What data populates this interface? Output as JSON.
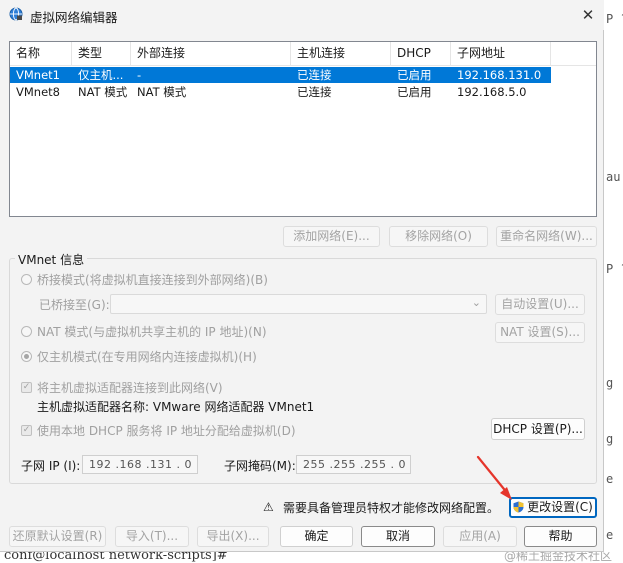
{
  "window": {
    "title": "虚拟网络编辑器",
    "close_symbol": "✕"
  },
  "list": {
    "headers": [
      "名称",
      "类型",
      "外部连接",
      "主机连接",
      "DHCP",
      "子网地址"
    ],
    "rows": [
      [
        "VMnet1",
        "仅主机...",
        "-",
        "已连接",
        "已启用",
        "192.168.131.0"
      ],
      [
        "VMnet8",
        "NAT 模式",
        "NAT 模式",
        "已连接",
        "已启用",
        "192.168.5.0"
      ]
    ],
    "selected_row": 0
  },
  "list_buttons": {
    "add": "添加网络(E)...",
    "remove": "移除网络(O)",
    "rename": "重命名网络(W)..."
  },
  "vmnet_info": {
    "label": "VMnet 信息",
    "bridge_mode": "桥接模式(将虚拟机直接连接到外部网络)(B)",
    "bridged_to_label": "已桥接至(G):",
    "auto_settings": "自动设置(U)...",
    "nat_mode": "NAT 模式(与虚拟机共享主机的 IP 地址)(N)",
    "nat_settings": "NAT 设置(S)...",
    "host_only_mode": "仅主机模式(在专用网络内连接虚拟机)(H)",
    "selected_mode": "host-only",
    "connect_adapter": "将主机虚拟适配器连接到此网络(V)",
    "adapter_name": "主机虚拟适配器名称: VMware 网络适配器 VMnet1",
    "use_dhcp": "使用本地 DHCP 服务将 IP 地址分配给虚拟机(D)",
    "dhcp_settings": "DHCP 设置(P)...",
    "subnet_ip_label": "子网 IP (I):",
    "subnet_ip": "192 .168 .131 . 0",
    "subnet_mask_label": "子网掩码(M):",
    "subnet_mask": "255 .255 .255 . 0"
  },
  "admin_notice": {
    "warning_symbol": "⚠",
    "text": "需要具备管理员特权才能修改网络配置。",
    "change_settings": "更改设置(C)"
  },
  "footer_buttons": {
    "restore_defaults": "还原默认设置(R)",
    "import": "导入(T)...",
    "export": "导出(X)...",
    "ok": "确定",
    "cancel": "取消",
    "apply": "应用(A)",
    "help": "帮助"
  },
  "background": {
    "terminal_bottom": "conf@localhost network-scripts]#",
    "terminal_right": [
      "P ?",
      "au",
      "P ?",
      "g",
      "g",
      "e",
      "e"
    ],
    "watermark": "@稀土掘金技术社区"
  },
  "colors": {
    "selection": "#0078d7",
    "accent_border": "#0067c0",
    "arrow": "#e5352b"
  }
}
